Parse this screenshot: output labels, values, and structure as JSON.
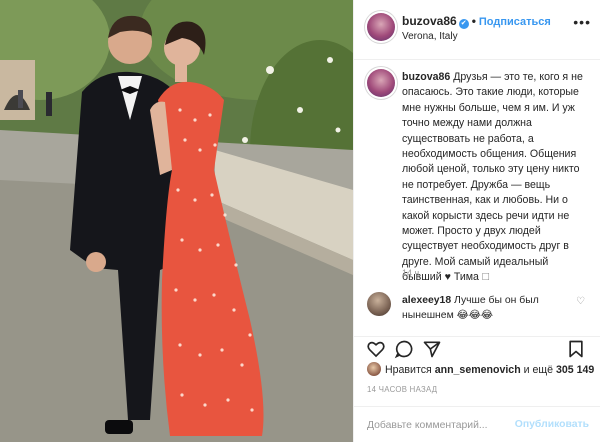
{
  "header": {
    "username": "buzova86",
    "verified_mark": "✔",
    "separator": "•",
    "follow_label": "Подписаться",
    "location": "Verona, Italy",
    "more_icon": "•••"
  },
  "caption": {
    "username": "buzova86",
    "text": "Друзья — это те, кого я не опасаюсь. Это такие люди, которые мне нужны больше, чем я им. И уж точно между нами должна существовать не работа, а необходимость общения. Общения любой ценой, только эту цену никто не потребует. Дружба — вещь таинственная, как и любовь. Ни о какой корысти здесь речи идти не может. Просто у двух людей существует необходимость друг в друге. Мой самый идеальный бывший ♥ Тима 🗆",
    "time": "14 ч."
  },
  "comment": {
    "username": "alexeey18",
    "text": "Лучше бы он был нынешнем 😂😂😂",
    "heart_icon": "♡"
  },
  "actions": {
    "icons": [
      "heart-icon",
      "comment-icon",
      "share-icon",
      "bookmark-icon"
    ]
  },
  "likes": {
    "prefix": "Нравится",
    "user": "ann_semenovich",
    "middle": "и ещё",
    "count": "305 149"
  },
  "posted_ago": "14 ЧАСОВ НАЗАД",
  "add_comment": {
    "placeholder": "Добавьте комментарий...",
    "publish_label": "Опубликовать"
  },
  "colors": {
    "accent": "#3897f0",
    "publish_disabled": "#b2dffc",
    "dress": "#e8553f"
  }
}
